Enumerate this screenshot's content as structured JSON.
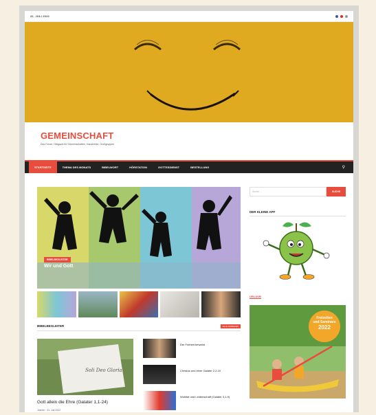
{
  "topbar": {
    "date": "31. JULI 2022"
  },
  "colors": {
    "accent": "#e84c3d",
    "hero": "#dfa920",
    "nav": "#222222"
  },
  "site": {
    "title": "GEMEINSCHAFT",
    "tagline": "Das Forum / Magazin für Gemeinschaften, Hauskreise, Großgruppen"
  },
  "nav": {
    "items": [
      "STARTSEITE",
      "THEMA DES MONATS",
      "BIBELWORT",
      "HÖRSTATION",
      "GOTTESDIENST",
      "BESTELLUNG"
    ],
    "search_icon": "search-icon"
  },
  "slider": {
    "badge": "BIBELBEGLEITER",
    "title": "Wir und Gott"
  },
  "section": {
    "label": "BIBELBEGLEITER",
    "more": "ALLE ANZEIGEN"
  },
  "feature": {
    "title": "Gott allein die Ehre (Galater 1,1-24)",
    "meta": "Jasmin · 31. Juli 2022",
    "card_text": "Soli Deo Gloria"
  },
  "list": [
    {
      "text": "Der Freiheit bewahrt"
    },
    {
      "text": "Christus und einer Galater 2,2-10"
    },
    {
      "text": "Wohltat und Leidenschaft (Galater 3,1-9)"
    }
  ],
  "sidebar": {
    "search_placeholder": "Suche ...",
    "search_button": "SUCHE",
    "widget1": "DER KLEINE APF",
    "widget2": "URLAUB",
    "promo_line1": "Freizeiten",
    "promo_line2": "und Seminare",
    "promo_year": "2022"
  }
}
